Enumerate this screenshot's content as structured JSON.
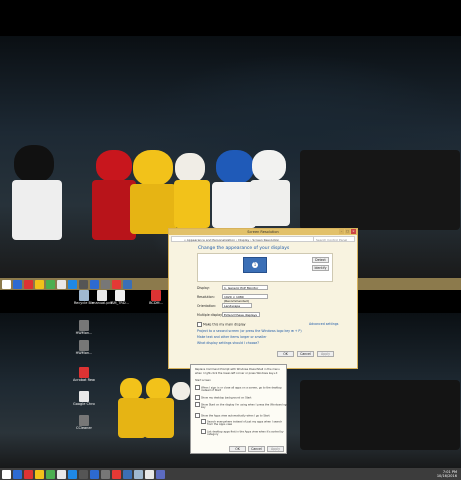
{
  "dialog": {
    "title": "Screen Resolution",
    "breadcrumb": "« Appearance and Personalization › Display › Screen Resolution",
    "search_placeholder": "Search Control Panel",
    "heading": "Change the appearance of your displays",
    "detect_label": "Detect",
    "identify_label": "Identify",
    "monitor_number": "1",
    "display_label": "Display:",
    "display_value": "1. Generic PnP Monitor",
    "resolution_label": "Resolution:",
    "resolution_value": "1920 × 1080 (Recommended)",
    "orientation_label": "Orientation:",
    "orientation_value": "Landscape",
    "multiple_displays_label": "Multiple displays:",
    "multiple_displays_value": "Extend these displays",
    "main_display_label": "Make this my main display",
    "advanced_settings_label": "Advanced settings",
    "project_link": "Project to a second screen (or press the Windows logo key ⊞ + P)",
    "text_size_link": "Make text and other items larger or smaller",
    "display_settings_link": "What display settings should I choose?",
    "ok_label": "OK",
    "cancel_label": "Cancel",
    "apply_label": "Apply"
  },
  "taskbar_dialog": {
    "lines": [
      "Replace Command Prompt with Windows PowerShell in the menu",
      "when I right-click the lower-left corner or press Windows key+X",
      "Start screen",
      "When I sign in or close all apps on a screen, go to the desktop",
      "instead of Start",
      "Show my desktop background on Start",
      "Show Start on the display I'm using when I press the Windows logo",
      "key",
      "Show the Apps view automatically when I go to Start",
      "Search everywhere instead of just my apps when I search",
      "from the Apps view",
      "List desktop apps first in the Apps view when it's sorted by",
      "category"
    ],
    "ok_label": "OK",
    "cancel_label": "Cancel",
    "apply_label": "Apply"
  },
  "desktop_icons": [
    {
      "label": "Recycle Bin",
      "color": "#9fb8d0"
    },
    {
      "label": "manual.pdf",
      "color": "#e8e8e8"
    },
    {
      "label": "AM_TRD...",
      "color": "#f0f0f0"
    },
    {
      "label": "BCDM...",
      "color": "#d33"
    },
    {
      "label": "HWMon...",
      "color": "#777"
    },
    {
      "label": "HWMon...",
      "color": "#777"
    },
    {
      "label": "Acrobat Reader DC",
      "color": "#d33"
    },
    {
      "label": "Google Chrome",
      "color": "#e8e8e8"
    },
    {
      "label": "CCleaner",
      "color": "#777"
    }
  ],
  "taskbar_top": {
    "clock": ""
  },
  "taskbar_bottom": {
    "clock_time": "7:01 PM",
    "clock_date": "10/16/2016"
  },
  "colors": {
    "taskbar_top": "#8c7a4c",
    "dialog_border": "#d7b25c",
    "accent": "#1e5aa8"
  }
}
